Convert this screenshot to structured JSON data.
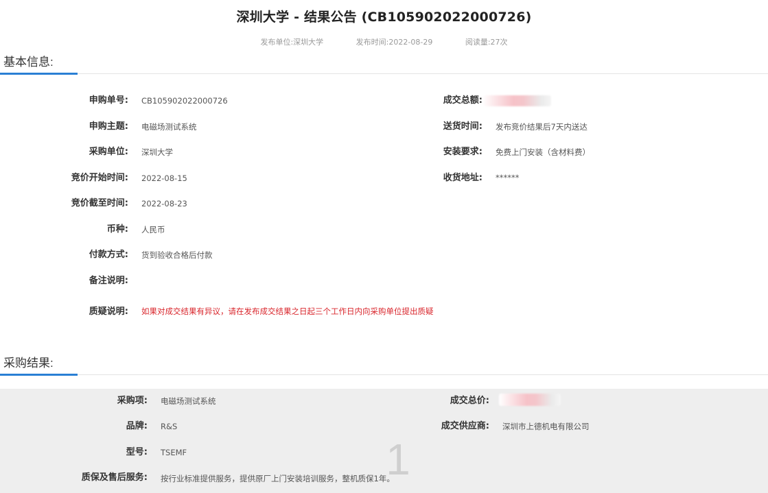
{
  "header": {
    "title": "深圳大学 - 结果公告 (CB105902022000726)",
    "publisher_label": "发布单位:",
    "publisher": "深圳大学",
    "publish_time_label": "发布时间:",
    "publish_time": "2022-08-29",
    "views_label": "阅读量:",
    "views": "27次"
  },
  "basic_info": {
    "section_title": "基本信息:",
    "left": [
      {
        "label": "申购单号:",
        "value": "CB105902022000726"
      },
      {
        "label": "申购主题:",
        "value": "电磁场测试系统"
      },
      {
        "label": "采购单位:",
        "value": "深圳大学"
      },
      {
        "label": "竞价开始时间:",
        "value": "2022-08-15"
      },
      {
        "label": "竞价截至时间:",
        "value": "2022-08-23"
      },
      {
        "label": "币种:",
        "value": "人民币"
      },
      {
        "label": "付款方式:",
        "value": "货到验收合格后付款"
      },
      {
        "label": "备注说明:",
        "value": ""
      },
      {
        "label": "质疑说明:",
        "value": "如果对成交结果有异议，请在发布成交结果之日起三个工作日内向采购单位提出质疑"
      }
    ],
    "right": [
      {
        "label": "成交总额:",
        "value": ""
      },
      {
        "label": "送货时间:",
        "value": "发布竞价结果后7天内送达"
      },
      {
        "label": "安装要求:",
        "value": "免费上门安装（含材料费）"
      },
      {
        "label": "收货地址:",
        "value": "******"
      }
    ]
  },
  "result": {
    "section_title": "采购结果:",
    "index": "1",
    "left": [
      {
        "label": "采购项:",
        "value": "电磁场测试系统"
      },
      {
        "label": "品牌:",
        "value": "R&S"
      },
      {
        "label": "型号:",
        "value": "TSEMF"
      },
      {
        "label": "质保及售后服务:",
        "value": "按行业标准提供服务，提供原厂上门安装培训服务，整机质保1年。"
      }
    ],
    "right": [
      {
        "label": "成交总价:",
        "value": ""
      },
      {
        "label": "成交供应商:",
        "value": "深圳市上德机电有限公司"
      }
    ]
  },
  "colors": {
    "accent": "#2a7fd4",
    "warning_text": "#d9262c",
    "panel_bg": "#eeeeee"
  }
}
